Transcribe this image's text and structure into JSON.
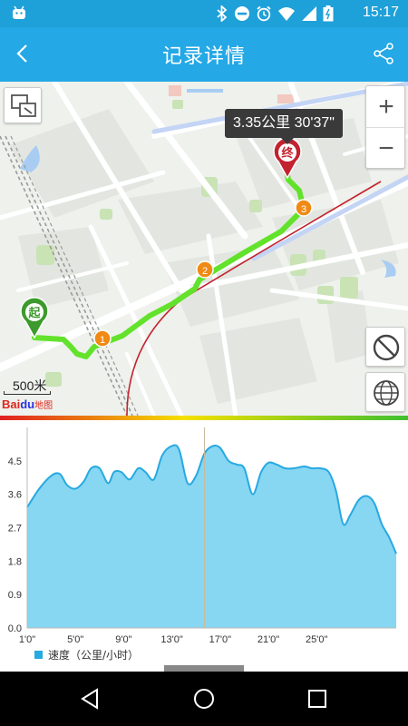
{
  "status_bar": {
    "time": "15:17",
    "icons": [
      "android-icon",
      "bluetooth-icon",
      "do-not-disturb-icon",
      "alarm-icon",
      "wifi-icon",
      "signal-icon",
      "battery-icon"
    ]
  },
  "header": {
    "title": "记录详情",
    "back_icon": "back-arrow-icon",
    "share_icon": "share-icon"
  },
  "map": {
    "tooltip": "3.35公里 30'37\"",
    "start_label": "起",
    "end_label": "终",
    "waypoints": [
      "1",
      "2",
      "3"
    ],
    "zoom_in_label": "+",
    "zoom_out_label": "−",
    "scale_label": "500米",
    "logo_text_1": "Bai",
    "logo_text_2": "du",
    "logo_text_3": "地图",
    "colors": {
      "route": "#62e22b",
      "waypoint": "#f08a14",
      "start_marker": "#3d9a2c",
      "end_marker": "#c2232e"
    }
  },
  "chart_data": {
    "type": "area",
    "legend": "速度（公里/小时）",
    "x_ticks": [
      "1'0\"",
      "5'0\"",
      "9'0\"",
      "13'0\"",
      "17'0\"",
      "21'0\"",
      "25'0\""
    ],
    "y_ticks": [
      "0.0",
      "0.9",
      "1.8",
      "2.7",
      "3.6",
      "4.5"
    ],
    "ylim": [
      0,
      5.4
    ],
    "xlim": [
      1,
      31.6
    ],
    "x": [
      1,
      2,
      3,
      3.7,
      4.3,
      5,
      5.7,
      6.3,
      7,
      7.7,
      8.2,
      8.8,
      9.5,
      10.2,
      10.8,
      11.5,
      12.2,
      13,
      13.6,
      14.3,
      15,
      15.7,
      16.4,
      17,
      17.7,
      18.4,
      19,
      19.7,
      20.4,
      21,
      21.7,
      22.4,
      23.1,
      24,
      24.6,
      25.3,
      26,
      26.6,
      27.2,
      27.8,
      28.5,
      29.2,
      29.8,
      30.4,
      31,
      31.6
    ],
    "y": [
      3.25,
      3.75,
      4.1,
      4.15,
      3.85,
      3.75,
      3.95,
      4.3,
      4.3,
      3.9,
      4.2,
      4.2,
      4.0,
      4.3,
      4.2,
      4.0,
      4.65,
      4.9,
      4.8,
      3.9,
      4.1,
      4.7,
      4.9,
      4.85,
      4.5,
      4.4,
      4.3,
      3.6,
      4.2,
      4.45,
      4.4,
      4.3,
      4.3,
      4.35,
      4.3,
      4.3,
      4.2,
      3.7,
      2.8,
      3.05,
      3.45,
      3.55,
      3.35,
      2.8,
      2.45,
      2.0
    ],
    "marker_x": 15.7,
    "colors": {
      "fill": "#87d6f2",
      "line": "#27a9e1",
      "marker": "#c9b99a"
    }
  }
}
